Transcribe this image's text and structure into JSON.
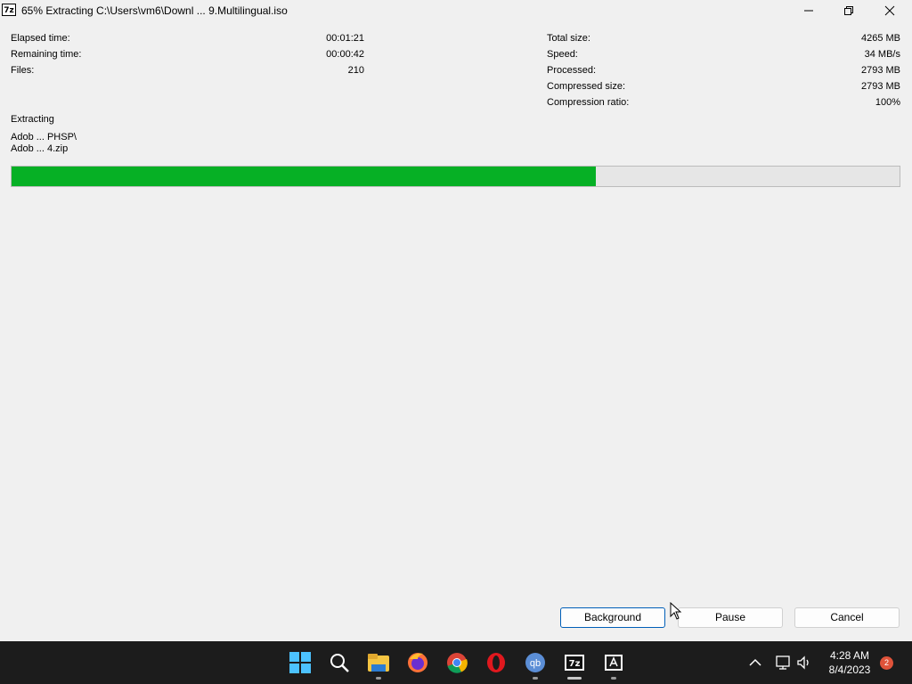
{
  "window": {
    "icon_label": "7z",
    "title": "65% Extracting C:\\Users\\vm6\\Downl ... 9.Multilingual.iso"
  },
  "stats_left": [
    {
      "label": "Elapsed time:",
      "value": "00:01:21"
    },
    {
      "label": "Remaining time:",
      "value": "00:00:42"
    },
    {
      "label": "Files:",
      "value": "210"
    }
  ],
  "stats_right": [
    {
      "label": "Total size:",
      "value": "4265 MB"
    },
    {
      "label": "Speed:",
      "value": "34 MB/s"
    },
    {
      "label": "Processed:",
      "value": "2793 MB"
    },
    {
      "label": "Compressed size:",
      "value": "2793 MB"
    },
    {
      "label": "Compression ratio:",
      "value": "100%"
    }
  ],
  "operation": {
    "label": "Extracting",
    "path_line1": "Adob ... PHSP\\",
    "path_line2": "Adob ... 4.zip"
  },
  "progress": {
    "fraction": 0.658,
    "color": "#06b025"
  },
  "buttons": {
    "background": "Background",
    "pause": "Pause",
    "cancel": "Cancel"
  },
  "taskbar": {
    "apps": [
      "windows-start",
      "search",
      "file-explorer",
      "firefox",
      "chrome",
      "opera",
      "qbittorrent",
      "7zip",
      "adobe-installer"
    ],
    "time": "4:28 AM",
    "date": "8/4/2023",
    "notification_count": "2"
  }
}
